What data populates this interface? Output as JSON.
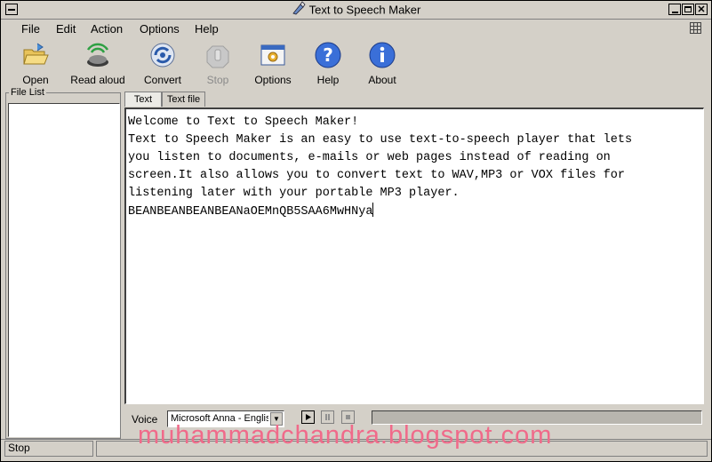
{
  "window": {
    "title": "Text to Speech Maker"
  },
  "menu": [
    {
      "label": "File"
    },
    {
      "label": "Edit"
    },
    {
      "label": "Action"
    },
    {
      "label": "Options"
    },
    {
      "label": "Help"
    }
  ],
  "toolbar": {
    "open": "Open",
    "read_aloud": "Read aloud",
    "convert": "Convert",
    "stop": "Stop",
    "options": "Options",
    "help": "Help",
    "about": "About"
  },
  "file_list": {
    "title": "File List"
  },
  "tabs": [
    {
      "label": "Text"
    },
    {
      "label": "Text file"
    }
  ],
  "editor": {
    "lines": [
      "Welcome to Text to Speech Maker!",
      "Text to Speech Maker is an easy to use text-to-speech player that lets",
      "you listen to documents, e-mails or web pages instead of reading on",
      "screen.It also allows you to convert text to WAV,MP3 or VOX files for",
      "listening later with your portable MP3 player.",
      "BEANBEANBEANBEANaOEMnQB5SAA6MwHNya"
    ]
  },
  "voice": {
    "label": "Voice",
    "selected": "Microsoft Anna - English"
  },
  "playback": {
    "progress": 0
  },
  "status": {
    "text": "Stop"
  },
  "watermark": "muhammadchandra.blogspot.com",
  "colors": {
    "watermark": "#f06a8a",
    "window_bg": "#d4d0c8"
  }
}
